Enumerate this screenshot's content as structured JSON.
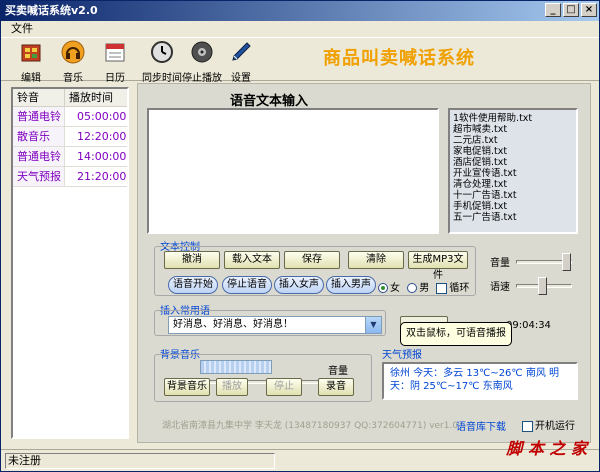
{
  "window": {
    "title": "买卖喊话系统v2.0",
    "controls": [
      "_",
      "□",
      "×"
    ]
  },
  "menu": {
    "file": "文件"
  },
  "toolbar": {
    "edit": "编辑",
    "music": "音乐",
    "calendar": "日历",
    "sync_time": "同步时间",
    "stop_play": "停止播放",
    "settings": "设置"
  },
  "brand_title": "商品叫卖喊话系统",
  "ringlist": {
    "header": {
      "name": "铃音",
      "time": "播放时间"
    },
    "rows": [
      {
        "name": "普通电铃声",
        "time": "05:00:00"
      },
      {
        "name": "散音乐",
        "time": "12:20:00"
      },
      {
        "name": "普通电铃声",
        "time": "14:00:00"
      },
      {
        "name": "天气预报",
        "time": "21:20:00"
      }
    ]
  },
  "voice_input": {
    "heading": "语音文本输入"
  },
  "files": [
    "1软件使用帮助.txt",
    "超市喊卖.txt",
    "二元店.txt",
    "家电促销.txt",
    "酒店促销.txt",
    "开业宣传语.txt",
    "清仓处理.txt",
    "十一广告语.txt",
    "手机促销.txt",
    "五一广告语.txt"
  ],
  "text_control": {
    "title": "文本控制",
    "buttons": {
      "undo": "撤消",
      "load": "载入文本",
      "save": "保存",
      "clear": "清除",
      "mp3": "生成MP3文件"
    },
    "pills": {
      "start": "语音开始",
      "stop": "停止语音",
      "insert_female": "插入女声",
      "insert_male": "插入男声"
    },
    "gender_female": "女",
    "gender_male": "男",
    "loop": "循环",
    "volume_label": "音量",
    "speed_label": "语速"
  },
  "phrases": {
    "title": "插入常用语",
    "value": "好消息、好消息、好消息！",
    "clock": "09:04:34"
  },
  "bgmusic": {
    "title": "背景音乐",
    "volume_label": "音量",
    "buttons": {
      "bg": "背景音乐",
      "play": "播放",
      "stop": "停止",
      "record": "录音"
    }
  },
  "weather": {
    "title": "天气预报",
    "line1": "徐州  今天：多云 13℃~26℃  南风   明",
    "line2": "天：阴 25℃~17℃ 东南风"
  },
  "tooltip": "双击鼠标，可语音播报",
  "footer_info": "湖北省南漳县九集中学   李天龙 (13487180937 QQ:372604771)   ver1.0",
  "voice_download": "语音库下载",
  "autostart": "开机运行",
  "status": "未注册",
  "watermark": "脚 本 之 家"
}
